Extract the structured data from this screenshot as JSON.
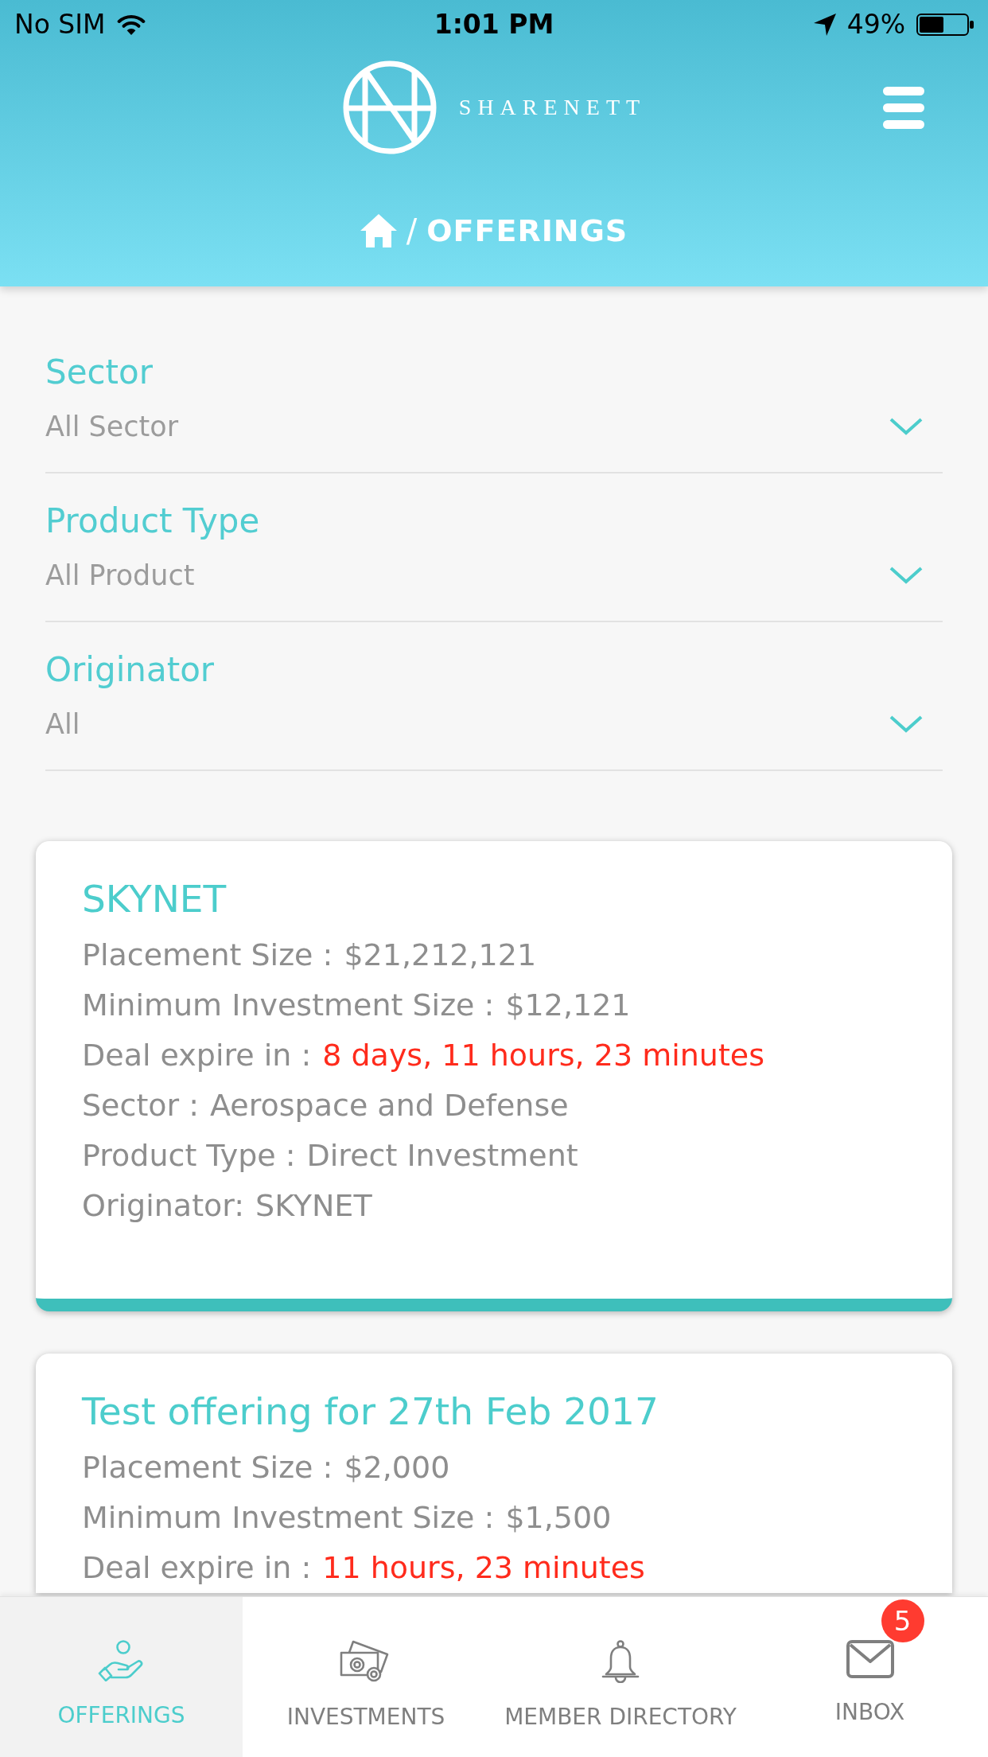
{
  "status_bar": {
    "carrier": "No SIM",
    "time": "1:01 PM",
    "battery": "49%"
  },
  "header": {
    "brand": "SHARENETT",
    "breadcrumb_separator": "/",
    "page_title": "OFFERINGS"
  },
  "filters": [
    {
      "label": "Sector",
      "value": "All Sector"
    },
    {
      "label": "Product Type",
      "value": "All Product"
    },
    {
      "label": "Originator",
      "value": "All"
    }
  ],
  "offerings": [
    {
      "title": "SKYNET",
      "details": [
        {
          "kind": "text",
          "label": "Placement Size :",
          "value": "$21,212,121"
        },
        {
          "kind": "text",
          "label": "Minimum Investment Size :",
          "value": "$12,121"
        },
        {
          "kind": "countdown",
          "label": "Deal expire in :",
          "value": "8 days, 11 hours, 23 minutes"
        },
        {
          "kind": "text",
          "label": "Sector :",
          "value": "Aerospace and Defense"
        },
        {
          "kind": "text",
          "label": "Product Type :",
          "value": "Direct Investment"
        },
        {
          "kind": "text",
          "label": "Originator:",
          "value": "SKYNET"
        }
      ]
    },
    {
      "title": "Test offering for 27th Feb 2017",
      "details": [
        {
          "kind": "text",
          "label": "Placement Size :",
          "value": "$2,000"
        },
        {
          "kind": "text",
          "label": "Minimum Investment Size :",
          "value": "$1,500"
        },
        {
          "kind": "countdown",
          "label": "Deal expire in :",
          "value": "11 hours, 23 minutes"
        }
      ]
    }
  ],
  "bottom_nav": [
    {
      "kind": "offerings",
      "label": "OFFERINGS",
      "selected": true
    },
    {
      "kind": "investments",
      "label": "INVESTMENTS",
      "selected": false
    },
    {
      "kind": "directory",
      "label": "MEMBER DIRECTORY",
      "selected": false
    },
    {
      "kind": "inbox",
      "label": "INBOX",
      "selected": false,
      "badge": "5"
    }
  ]
}
